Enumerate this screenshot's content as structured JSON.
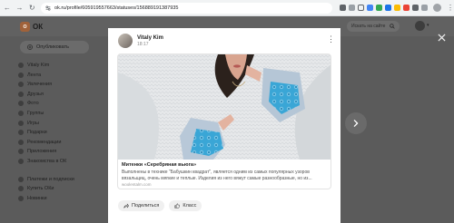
{
  "browser": {
    "url": "ok.ru/profile/605919557663/statuses/156889191387935"
  },
  "ok": {
    "logo_text": "ОК",
    "search_placeholder": "Искать на сайте",
    "publish_label": "Опубликовать",
    "nav": {
      "main": [
        {
          "icon": "user-icon",
          "label": "Vitaly Kim"
        },
        {
          "icon": "feed-icon",
          "label": "Лента"
        },
        {
          "icon": "bell-icon",
          "label": "Увлечения"
        },
        {
          "icon": "friends-icon",
          "label": "Друзья"
        },
        {
          "icon": "photo-icon",
          "label": "Фото"
        },
        {
          "icon": "groups-icon",
          "label": "Группы"
        },
        {
          "icon": "games-icon",
          "label": "Игры"
        },
        {
          "icon": "gift-icon",
          "label": "Подарки"
        },
        {
          "icon": "star-icon",
          "label": "Рекомендации"
        },
        {
          "icon": "apps-icon",
          "label": "Приложения"
        },
        {
          "icon": "heart-icon",
          "label": "Знакомства в ОК"
        }
      ],
      "extra": [
        {
          "icon": "card-icon",
          "label": "Платежи и подписки"
        },
        {
          "icon": "coin-icon",
          "label": "Купить ОКи"
        },
        {
          "icon": "news-icon",
          "label": "Новинки"
        }
      ]
    }
  },
  "post": {
    "author": "Vitaly Kim",
    "time": "18:17",
    "card_title": "Митенки «Серебряная вьюга»",
    "card_desc": "Выполнены в технике \"Бабушкин квадрат\", является одним из самых популярных узоров вязальщиц, очень мягкие и теплые. Изделия из него вяжут самые разнообразные, но из...",
    "card_source": "woolentalm.com",
    "share_label": "Поделиться",
    "like_label": "Класс"
  },
  "colors": {
    "ok_orange": "#ee8208",
    "overlay": "#585858",
    "mitten_blue": "#3aa6d6"
  }
}
